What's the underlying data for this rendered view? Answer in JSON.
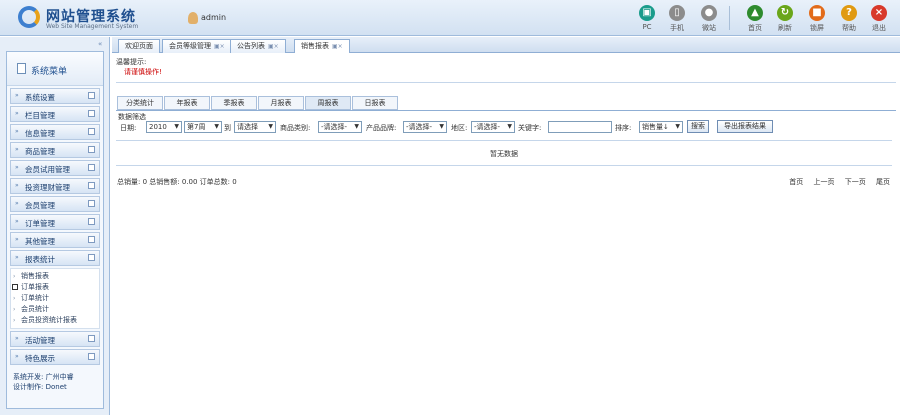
{
  "app": {
    "title": "网站管理系统",
    "subtitle": "Web Site Management System",
    "logo_letter": "C",
    "user": "admin"
  },
  "toolbar": [
    {
      "label": "PC",
      "color": "#1a9c8c",
      "glyph": "▣",
      "icon": "pc-icon"
    },
    {
      "label": "手机",
      "color": "#8c8c8c",
      "glyph": "▯",
      "icon": "mobile-icon"
    },
    {
      "label": "微站",
      "color": "#8c8c8c",
      "glyph": "●",
      "icon": "wechat-icon"
    },
    {
      "label": "首页",
      "color": "#2e8b2e",
      "glyph": "▲",
      "icon": "home-icon"
    },
    {
      "label": "刷新",
      "color": "#6aa61a",
      "glyph": "↻",
      "icon": "refresh-icon"
    },
    {
      "label": "锁屏",
      "color": "#e26b1a",
      "glyph": "■",
      "icon": "lock-icon"
    },
    {
      "label": "帮助",
      "color": "#e09a12",
      "glyph": "?",
      "icon": "help-icon"
    },
    {
      "label": "退出",
      "color": "#d8392b",
      "glyph": "×",
      "icon": "logout-icon"
    }
  ],
  "sidebar": {
    "collapse": "«",
    "title": "系统菜单",
    "items": [
      {
        "label": "系统设置"
      },
      {
        "label": "栏目管理"
      },
      {
        "label": "信息管理"
      },
      {
        "label": "商品管理"
      },
      {
        "label": "会员试用管理"
      },
      {
        "label": "投资理财管理"
      },
      {
        "label": "会员管理"
      },
      {
        "label": "订单管理"
      },
      {
        "label": "其他管理"
      },
      {
        "label": "报表统计"
      }
    ],
    "sub_items": [
      {
        "label": "销售报表",
        "active": false
      },
      {
        "label": "订单报表",
        "active": true
      },
      {
        "label": "订单统计",
        "active": false
      },
      {
        "label": "会员统计",
        "active": false
      },
      {
        "label": "会员投资统计报表",
        "active": false
      }
    ],
    "tail_items": [
      {
        "label": "活动管理"
      },
      {
        "label": "特色展示"
      }
    ],
    "footer": [
      "系统开发: 广州中睿",
      "设计制作: Donet"
    ]
  },
  "tabs": [
    {
      "label": "欢迎页面",
      "closable": false,
      "active": false
    },
    {
      "label": "会员等级管理",
      "closable": true,
      "active": false
    },
    {
      "label": "公告列表",
      "closable": true,
      "active": false
    },
    {
      "label": "销售报表",
      "closable": true,
      "active": true
    }
  ],
  "tip": {
    "title": "温馨提示:",
    "text": "请谨慎操作!"
  },
  "sub_tabs": [
    {
      "label": "分类统计",
      "active": false
    },
    {
      "label": "年报表",
      "active": false
    },
    {
      "label": "季报表",
      "active": false
    },
    {
      "label": "月报表",
      "active": false
    },
    {
      "label": "周报表",
      "active": true
    },
    {
      "label": "日报表",
      "active": false
    }
  ],
  "conditions": {
    "title": "数据筛选",
    "date_label": "日期:",
    "year": "2010",
    "week": "第7周",
    "to_label": "到",
    "week2": "请选择",
    "category_label": "商品类别:",
    "category": "-请选择-",
    "brand_label": "产品品牌:",
    "brand": "-请选择-",
    "region_label": "地区:",
    "region": "-请选择-",
    "keyword_label": "关键字:",
    "keyword": "",
    "sort_label": "排序:",
    "sort": "销售量↓",
    "search_btn": "搜索",
    "export_btn": "导出报表结果"
  },
  "table": {
    "empty_text": "暂无数据"
  },
  "summary": {
    "text": "总销量: 0  总销售额: 0.00  订单总数: 0"
  },
  "pager": {
    "first": "首页",
    "prev": "上一页",
    "next": "下一页",
    "last": "尾页"
  }
}
